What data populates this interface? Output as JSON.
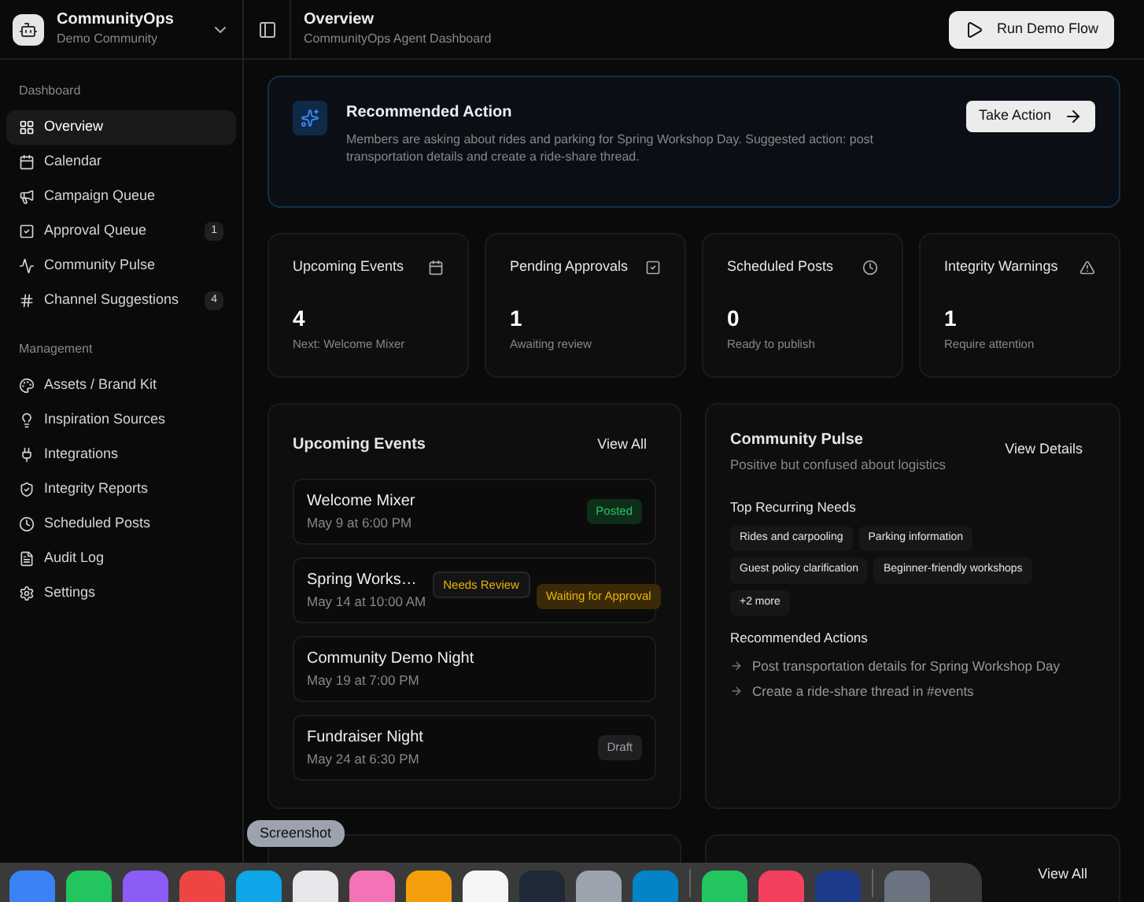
{
  "workspace": {
    "name": "CommunityOps",
    "subtitle": "Demo Community"
  },
  "sidebar": {
    "sections": [
      {
        "title": "Dashboard",
        "items": [
          {
            "label": "Overview",
            "selected": true
          },
          {
            "label": "Calendar",
            "selected": false
          },
          {
            "label": "Campaign Queue",
            "selected": false
          },
          {
            "label": "Approval Queue",
            "selected": false,
            "badge": "1"
          },
          {
            "label": "Community Pulse",
            "selected": false
          },
          {
            "label": "Channel Suggestions",
            "selected": false,
            "badge": "4"
          }
        ]
      },
      {
        "title": "Management",
        "items": [
          {
            "label": "Assets / Brand Kit",
            "selected": false
          },
          {
            "label": "Inspiration Sources",
            "selected": false
          },
          {
            "label": "Integrations",
            "selected": false
          },
          {
            "label": "Integrity Reports",
            "selected": false
          },
          {
            "label": "Scheduled Posts",
            "selected": false
          },
          {
            "label": "Audit Log",
            "selected": false
          },
          {
            "label": "Settings",
            "selected": false
          }
        ]
      }
    ]
  },
  "header": {
    "title": "Overview",
    "subtitle": "CommunityOps Agent Dashboard",
    "button": "Run Demo Flow"
  },
  "recommended": {
    "title": "Recommended Action",
    "text": "Members are asking about rides and parking for Spring Workshop Day. Suggested action: post transportation details and create a ride-share thread.",
    "button": "Take Action"
  },
  "stats": [
    {
      "title": "Upcoming Events",
      "value": "4",
      "caption": "Next: Welcome Mixer"
    },
    {
      "title": "Pending Approvals",
      "value": "1",
      "caption": "Awaiting review"
    },
    {
      "title": "Scheduled Posts",
      "value": "0",
      "caption": "Ready to publish"
    },
    {
      "title": "Integrity Warnings",
      "value": "1",
      "caption": "Require attention"
    }
  ],
  "events": {
    "title": "Upcoming Events",
    "link": "View All",
    "items": [
      {
        "name": "Welcome Mixer",
        "date": "May 9 at 6:00 PM",
        "badges": [
          {
            "label": "Posted",
            "kind": "posted"
          }
        ]
      },
      {
        "name": "Spring Works…",
        "date": "May 14 at 10:00 AM",
        "badges": [
          {
            "label": "Needs Review",
            "kind": "review"
          },
          {
            "label": "Waiting for Approval",
            "kind": "waiting"
          }
        ]
      },
      {
        "name": "Community Demo Night",
        "date": "May 19 at 7:00 PM"
      },
      {
        "name": "Fundraiser Night",
        "date": "May 24 at 6:30 PM",
        "badges": [
          {
            "label": "Draft",
            "kind": "draft"
          }
        ]
      }
    ]
  },
  "pulse": {
    "title": "Community Pulse",
    "subtitle": "Positive but confused about logistics",
    "link": "View Details",
    "needs_title": "Top Recurring Needs",
    "needs": [
      "Rides and carpooling",
      "Parking information",
      "Guest policy clarification",
      "Beginner-friendly workshops",
      "+2 more"
    ],
    "actions_title": "Recommended Actions",
    "actions": [
      "Post transportation details for Spring Workshop Day",
      "Create a ride-share thread in #events"
    ]
  },
  "integrity_card": {
    "link": "View All"
  },
  "dock": {
    "tooltip": "Screenshot"
  }
}
